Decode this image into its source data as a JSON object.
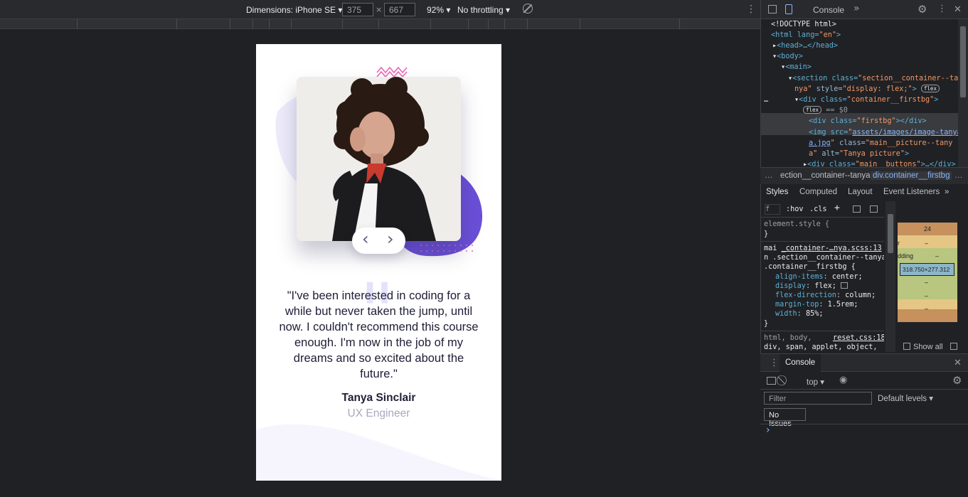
{
  "device_toolbar": {
    "dimensions_label": "Dimensions: iPhone SE",
    "width_value": "375",
    "height_value": "667",
    "times": "×",
    "zoom": "92%",
    "throttling": "No throttling",
    "dropdown_caret": "▾",
    "more": "⋮"
  },
  "page": {
    "quote_mark": "\"",
    "testimonial": "\"I've been interested in coding for a while but never taken the jump, until now. I couldn't recommend this course enough. I'm now in the job of my dreams and so excited about the future.\"",
    "author": "Tanya Sinclair",
    "role": "UX Engineer",
    "prev": "‹",
    "next": "›",
    "colors": {
      "accent": "#6b4fd8",
      "blob": "#e8e6fb",
      "pink": "#e96ab3",
      "text": "#202038",
      "muted": "#a8a8c0"
    }
  },
  "devtools": {
    "tabs": {
      "console": "Console",
      "more": "»",
      "more_menu": "⋮",
      "close": "✕"
    },
    "dom": {
      "doctype": "<!DOCTYPE html>",
      "html_open": "<html lang=",
      "html_lang": "\"en\"",
      "html_close": ">",
      "head": "<head>…</head>",
      "body": "<body>",
      "main": "<main>",
      "section_open": "<section class=",
      "section_class_a": "\"section__container--ta",
      "section_class_b": "nya\"",
      "style_attr": " style=",
      "style_val": "\"display: flex;\"",
      "gt": ">",
      "flex_badge": "flex",
      "ellipsis": "…",
      "div_open": "<div class=",
      "div_class": "\"container__firstbg\"",
      "eq0": "== $0",
      "firstbg_open": "<div class=",
      "firstbg_class": "\"firstbg\"",
      "firstbg_close": "></div>",
      "img_open": "<img src=",
      "img_src_a": "assets/images/image-tanya",
      "img_src_b": "a.jpg",
      "img_class_attr": " class=",
      "img_class_a": "\"main__picture--tany",
      "img_class_b": "a\"",
      "img_alt_attr": " alt=",
      "img_alt_val": "\"Tanya picture\"",
      "buttons_open": "<div class=",
      "buttons_class": "\"main__buttons\"",
      "buttons_close": ">…</div>",
      "quote": "\""
    },
    "breadcrumbs": [
      "…",
      "ection__container--tanya",
      "div.container__firstbg",
      "…"
    ],
    "styles_tabs": [
      "Styles",
      "Computed",
      "Layout",
      "Event Listeners",
      "»"
    ],
    "filter": {
      "placeholder": "f",
      "hov": ":hov",
      "cls": ".cls",
      "plus": "+"
    },
    "styles": {
      "element_style": "element.style {",
      "close_brace": "}",
      "source_prefix": "mai",
      "source_link": "_container-…nya.scss:13",
      "rule_sel_a": "n .section__container--tanya",
      "rule_sel_b": ".container__firstbg {",
      "props": [
        {
          "name": "align-items",
          "value": "center;"
        },
        {
          "name": "display",
          "value": "flex;"
        },
        {
          "name": "flex-direction",
          "value": "column;"
        },
        {
          "name": "margin-top",
          "value": "1.5rem;"
        },
        {
          "name": "width",
          "value": "85%;"
        }
      ],
      "reset_sel": "html, body,",
      "reset_link": "reset.css:18",
      "reset_sel_b": "div, span, applet, object,"
    },
    "box_model": {
      "margin": "24",
      "border_prefix": "r",
      "border_dash": "–",
      "padding_label": "dding",
      "padding_dash": "–",
      "content": "318.750×277.312",
      "bottom_dashes": [
        "–",
        "–",
        "–"
      ],
      "show_all": "Show all"
    },
    "console": {
      "title": "Console",
      "context": "top",
      "filter_placeholder": "Filter",
      "levels": "Default levels",
      "issues": "No Issues",
      "prompt": "›"
    }
  }
}
